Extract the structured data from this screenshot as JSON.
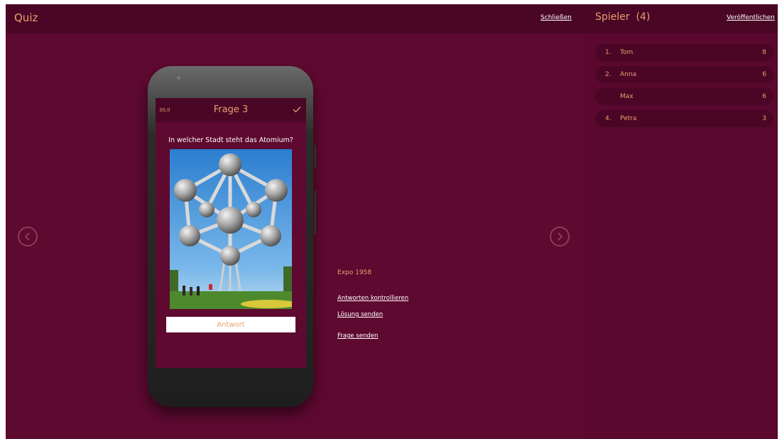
{
  "header": {
    "title": "Quiz",
    "close_label": "Schließen",
    "players_title": "Spieler",
    "players_count": "(4)",
    "publish_label": "Veröffentlichen"
  },
  "players": [
    {
      "rank": "1.",
      "name": "Tom",
      "score": "8"
    },
    {
      "rank": "2.",
      "name": "Anna",
      "score": "6"
    },
    {
      "rank": "",
      "name": "Max",
      "score": "6"
    },
    {
      "rank": "4.",
      "name": "Petra",
      "score": "3"
    }
  ],
  "phone": {
    "timer": "30,0",
    "question_title": "Frage 3",
    "question_text": "In welcher Stadt steht das Atomium?",
    "answer_placeholder": "Antwort"
  },
  "controls": {
    "solution": "Expo 1958",
    "check_answers": "Antworten kontrollieren",
    "send_solution": "Lösung senden",
    "send_question": "Frage senden"
  },
  "colors": {
    "background": "#5e0930",
    "header": "#4a0625",
    "accent": "#e8a070"
  },
  "icons": {
    "prev": "chevron-left-circle-icon",
    "next": "chevron-right-circle-icon",
    "check": "check-icon"
  }
}
